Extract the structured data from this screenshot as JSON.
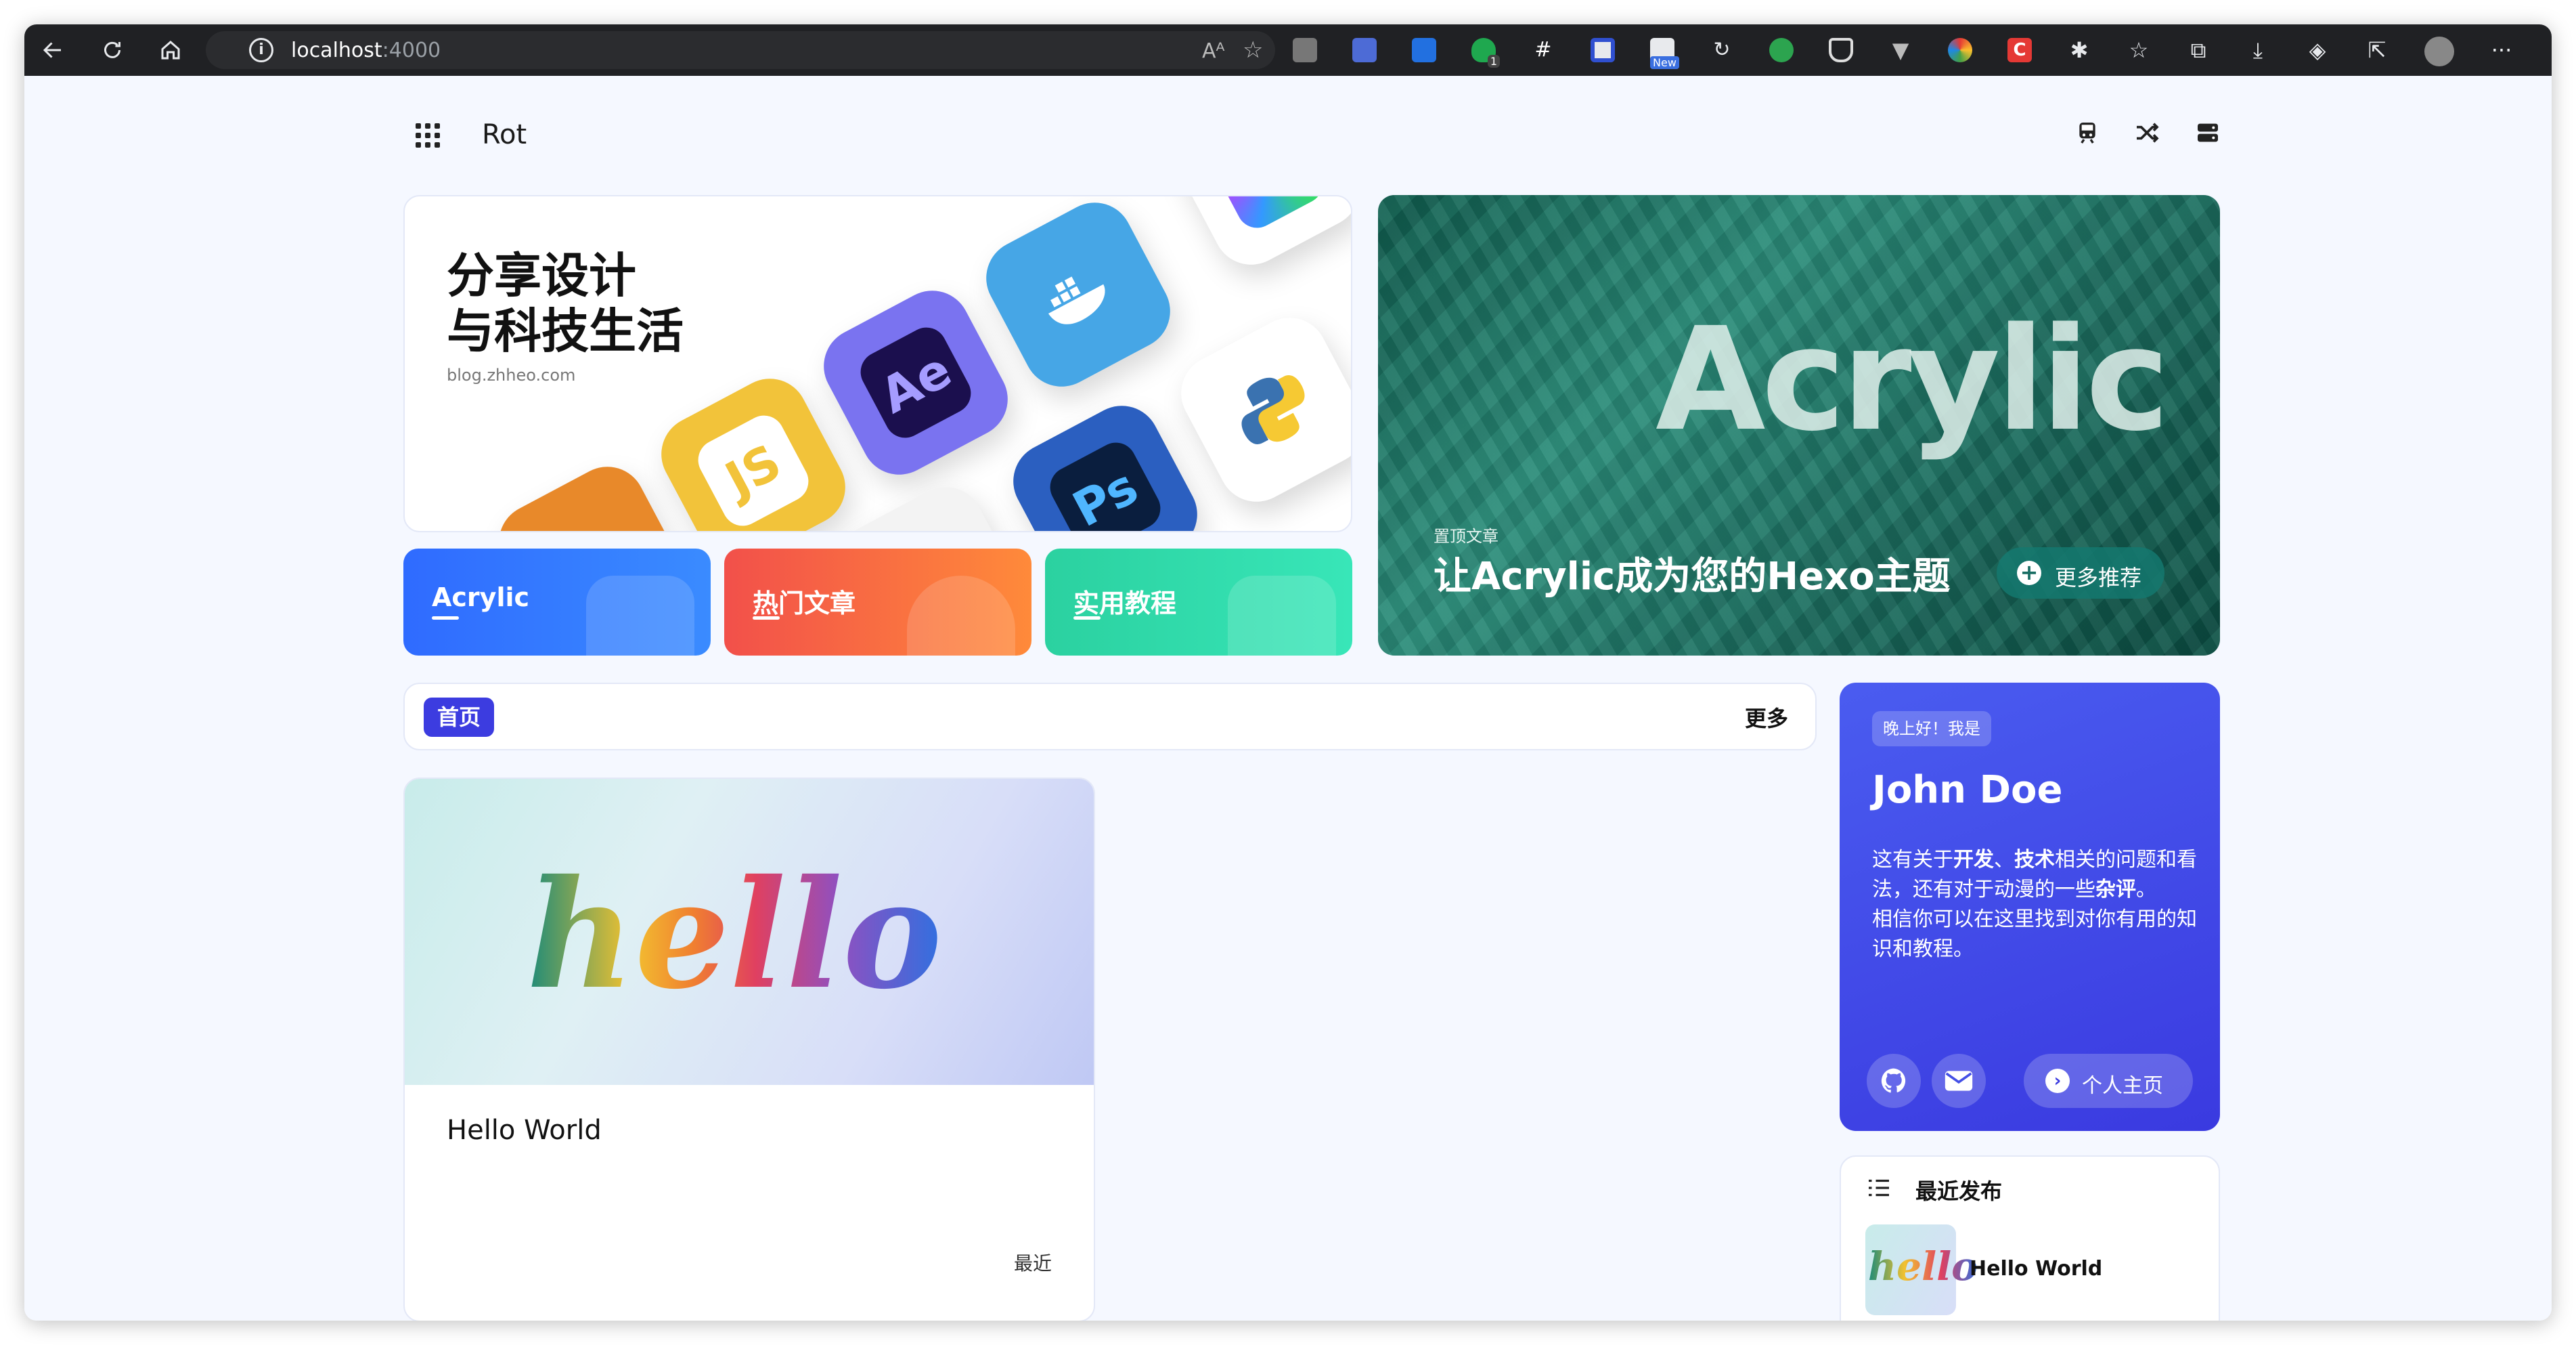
{
  "browser": {
    "url_host": "localhost",
    "url_port": ":4000",
    "extensions": [
      "reader-icon",
      "bookmark-icon",
      "ms-icon",
      "shield-icon",
      "hash-icon",
      "note-icon",
      "new-icon",
      "refresh-ext-icon",
      "link-icon",
      "shield2-icon",
      "vue-icon",
      "color-icon",
      "c-icon"
    ],
    "ext_badge_new": "New",
    "ext_badge_count": "1"
  },
  "nav": {
    "site_title": "Rot"
  },
  "hero": {
    "title_line1": "分享设计",
    "title_line2": "与科技生活",
    "subtitle": "blog.zhheo.com",
    "tiles": [
      "JS",
      "Ae",
      "Ps",
      "docker-icon",
      "python-icon"
    ]
  },
  "categories": [
    {
      "label": "Acrylic",
      "color_start": "#2f6bff",
      "color_end": "#3a8bff"
    },
    {
      "label": "热门文章",
      "color_start": "#f2504a",
      "color_end": "#ff8a3a"
    },
    {
      "label": "实用教程",
      "color_start": "#2bd1a0",
      "color_end": "#38e6b8"
    }
  ],
  "feature": {
    "bg_word": "Acrylic",
    "label": "置顶文章",
    "title": "让Acrylic成为您的Hexo主题",
    "button": "更多推荐"
  },
  "tabs": {
    "home": "首页",
    "more": "更多"
  },
  "post": {
    "image_text": "hello",
    "title": "Hello World",
    "tag": "最近"
  },
  "author": {
    "greeting": "晚上好！我是",
    "name": "John Doe",
    "bio_1": "这有关于",
    "bio_b1": "开发",
    "bio_2": "、",
    "bio_b2": "技术",
    "bio_3": "相关的问题和看法，还有对于动漫的一些",
    "bio_b3": "杂评",
    "bio_4": "。",
    "bio_5": "相信你可以在这里找到对你有用的知识和教程。",
    "home_button": "个人主页"
  },
  "recent": {
    "title": "最近发布",
    "thumb_text": "hello",
    "item_title": "Hello World"
  },
  "colors": {
    "accent": "#3c3ce0",
    "page_bg": "#f5f8ff"
  }
}
